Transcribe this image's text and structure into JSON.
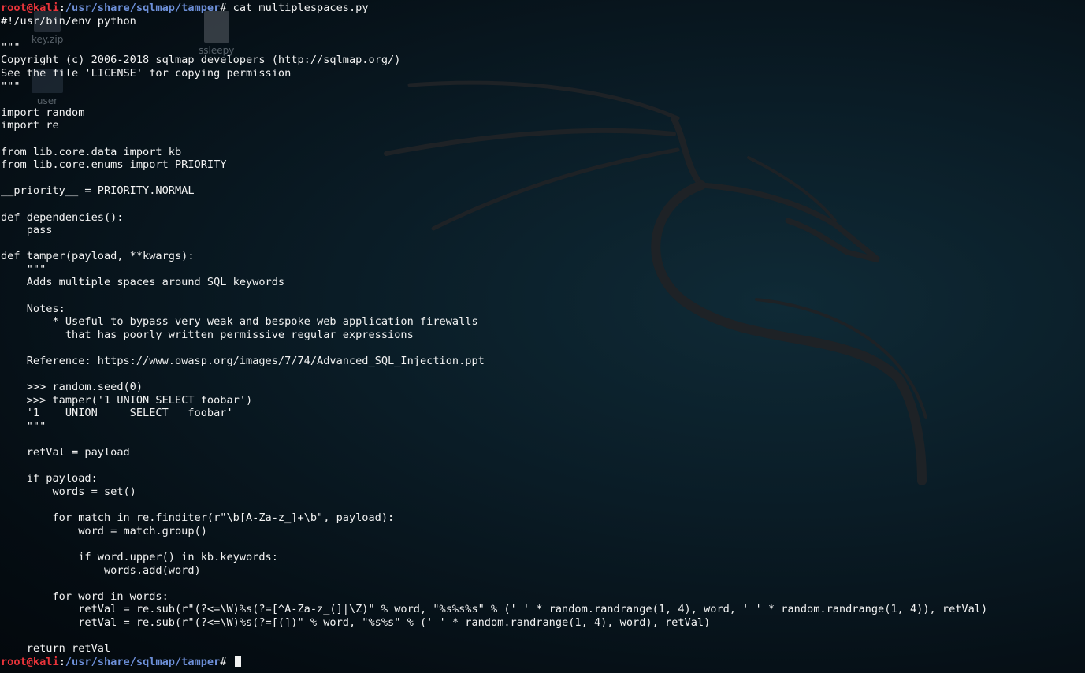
{
  "prompt": {
    "user_host": "root@kali",
    "separator": ":",
    "path": "/usr/share/sqlmap/tamper",
    "hash": "# "
  },
  "command": "cat multiplespaces.py",
  "desktop_icons": [
    {
      "label": "key.zip",
      "icon": "zip-file-icon"
    },
    {
      "label": "user",
      "icon": "folder-icon"
    },
    {
      "label": "ssleepy",
      "icon": "document-icon"
    }
  ],
  "file_lines": [
    "#!/usr/bin/env python",
    "",
    "\"\"\"",
    "Copyright (c) 2006-2018 sqlmap developers (http://sqlmap.org/)",
    "See the file 'LICENSE' for copying permission",
    "\"\"\"",
    "",
    "import random",
    "import re",
    "",
    "from lib.core.data import kb",
    "from lib.core.enums import PRIORITY",
    "",
    "__priority__ = PRIORITY.NORMAL",
    "",
    "def dependencies():",
    "    pass",
    "",
    "def tamper(payload, **kwargs):",
    "    \"\"\"",
    "    Adds multiple spaces around SQL keywords",
    "",
    "    Notes:",
    "        * Useful to bypass very weak and bespoke web application firewalls",
    "          that has poorly written permissive regular expressions",
    "",
    "    Reference: https://www.owasp.org/images/7/74/Advanced_SQL_Injection.ppt",
    "",
    "    >>> random.seed(0)",
    "    >>> tamper('1 UNION SELECT foobar')",
    "    '1    UNION     SELECT   foobar'",
    "    \"\"\"",
    "",
    "    retVal = payload",
    "",
    "    if payload:",
    "        words = set()",
    "",
    "        for match in re.finditer(r\"\\b[A-Za-z_]+\\b\", payload):",
    "            word = match.group()",
    "",
    "            if word.upper() in kb.keywords:",
    "                words.add(word)",
    "",
    "        for word in words:",
    "            retVal = re.sub(r\"(?<=\\W)%s(?=[^A-Za-z_(]|\\Z)\" % word, \"%s%s%s\" % (' ' * random.randrange(1, 4), word, ' ' * random.randrange(1, 4)), retVal)",
    "            retVal = re.sub(r\"(?<=\\W)%s(?=[(])\" % word, \"%s%s\" % (' ' * random.randrange(1, 4), word), retVal)",
    "",
    "    return retVal"
  ],
  "colors": {
    "prompt_user": "#e8343a",
    "prompt_path": "#6d8fd8",
    "text": "#f2f2f2",
    "background": "#0a1c26"
  }
}
